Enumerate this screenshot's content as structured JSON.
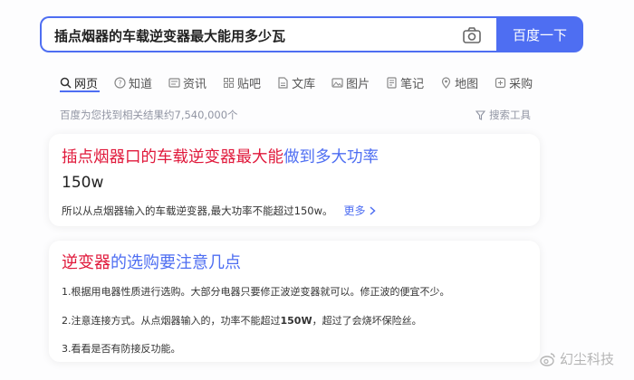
{
  "search": {
    "query": "插点烟器的车载逆变器最大能用多少瓦",
    "button_label": "百度一下",
    "camera_icon": "camera-icon"
  },
  "tabs": [
    {
      "label": "网页",
      "icon": "search-icon",
      "active": true
    },
    {
      "label": "知道",
      "icon": "question-icon"
    },
    {
      "label": "资讯",
      "icon": "news-icon"
    },
    {
      "label": "贴吧",
      "icon": "tieba-icon"
    },
    {
      "label": "文库",
      "icon": "document-icon"
    },
    {
      "label": "图片",
      "icon": "image-icon"
    },
    {
      "label": "笔记",
      "icon": "note-icon"
    },
    {
      "label": "地图",
      "icon": "map-pin-icon"
    },
    {
      "label": "采购",
      "icon": "purchase-icon"
    }
  ],
  "results_meta": {
    "count_text": "百度为您找到相关结果约7,540,000个",
    "tools_label": "搜索工具"
  },
  "answer_card": {
    "title_parts": [
      {
        "text": "插点烟器口的车载逆变器最大能",
        "style": "hl"
      },
      {
        "text": "做到多大功率",
        "style": "nm"
      }
    ],
    "answer": "150w",
    "snippet": "所以从点烟器输入的车载逆变器,最大功率不能超过150w。",
    "more_label": "更多"
  },
  "tips_card": {
    "title_parts": [
      {
        "text": "逆变器",
        "style": "hl"
      },
      {
        "text": "的选购要注意几点",
        "style": "nm"
      }
    ],
    "tip1": "1.根据用电器性质进行选购。大部分电器只要修正波逆变器就可以。修正波的便宜不少。",
    "tip2_before": "2.注意连接方式。从点烟器输入的，功率不能超过",
    "tip2_bold": "150W",
    "tip2_after": "，超过了会烧坏保险丝。",
    "tip3": "3.看看是否有防接反功能。"
  },
  "watermark": {
    "text": "幻尘科技"
  },
  "colors": {
    "accent": "#4e6ef2",
    "highlight": "#e0193b"
  }
}
